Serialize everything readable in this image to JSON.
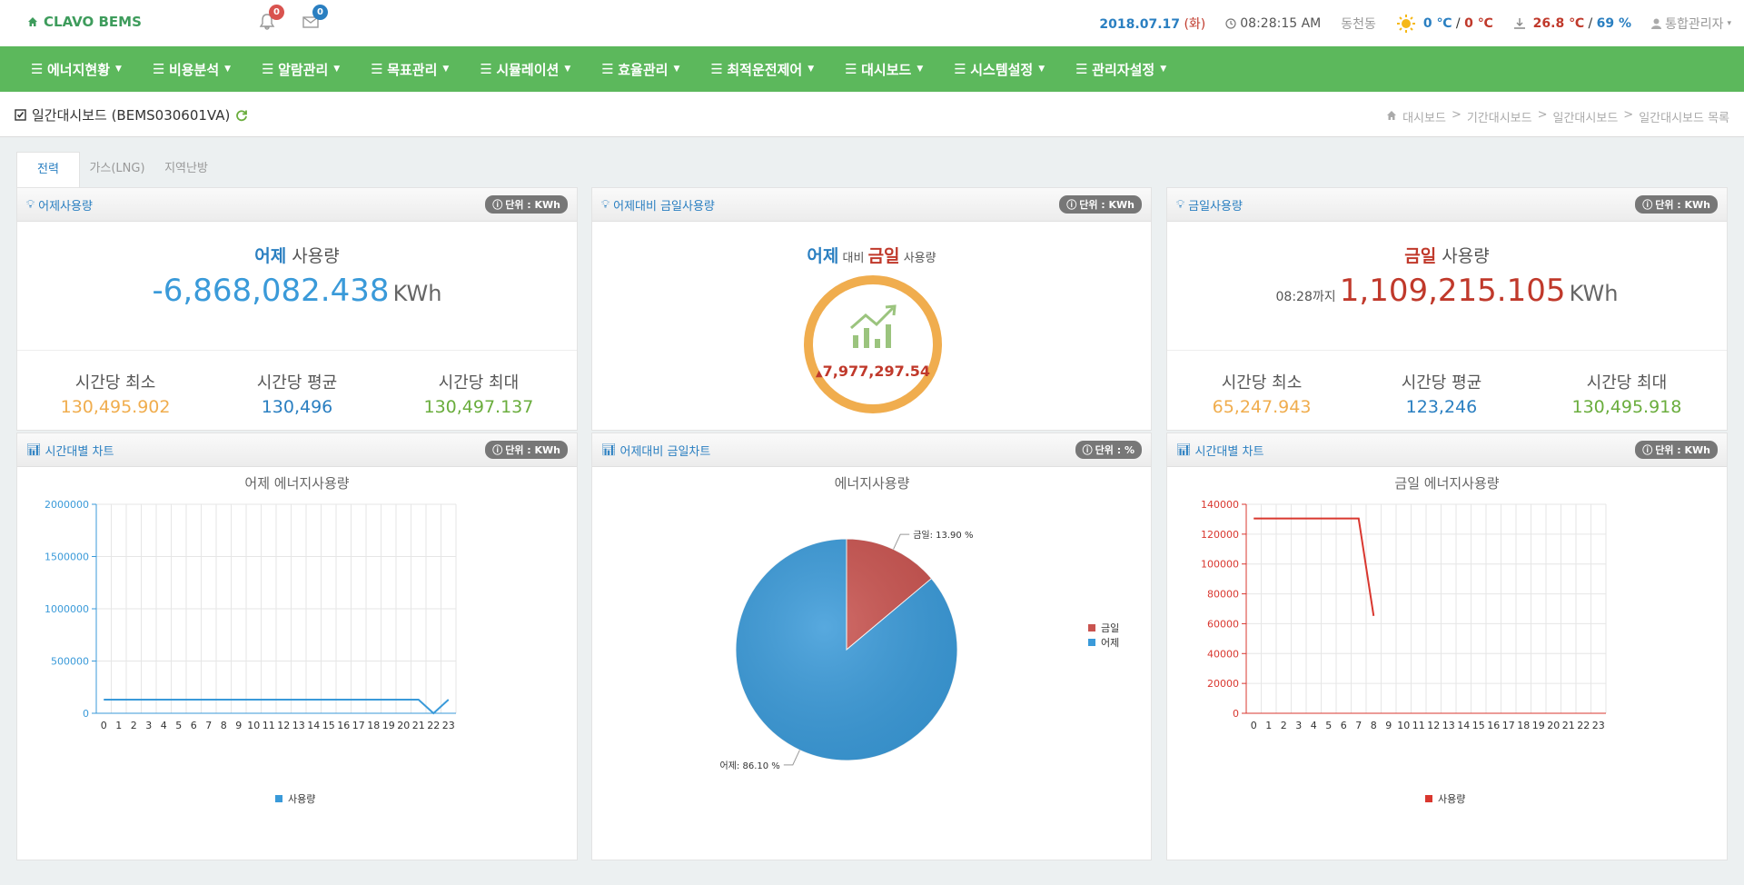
{
  "header": {
    "logo": "CLAVO BEMS",
    "bell_count": "0",
    "mail_count": "0",
    "date": "2018.07.17",
    "day": "(화)",
    "time": "08:28:15 AM",
    "region": "동천동",
    "out_temp1": "0 ℃",
    "out_sep": "/",
    "out_temp2": "0 ℃",
    "in_temp": "26.8 ℃",
    "in_sep": "/",
    "in_humidity": "69 %",
    "user": "통합관리자"
  },
  "nav": [
    "에너지현황",
    "비용분석",
    "알람관리",
    "목표관리",
    "시뮬레이션",
    "효율관리",
    "최적운전제어",
    "대시보드",
    "시스템설정",
    "관리자설정"
  ],
  "page": {
    "title": "일간대시보드 (BEMS030601VA)",
    "breadcrumb": [
      "대시보드",
      ">",
      "기간대시보드",
      ">",
      "일간대시보드",
      ">",
      "일간대시보드 목록"
    ]
  },
  "tabs": [
    "전력",
    "가스(LNG)",
    "지역난방"
  ],
  "panels": {
    "yesterday": {
      "title": "어제사용량",
      "unit": "단위 : KWh",
      "heading_em": "어제",
      "heading_rest": "사용량",
      "value": "-6,868,082.438",
      "value_unit": "KWh",
      "min_label": "시간당 최소",
      "min": "130,495.902",
      "avg_label": "시간당 평균",
      "avg": "130,496",
      "max_label": "시간당 최대",
      "max": "130,497.137"
    },
    "compare": {
      "title": "어제대비 금일사용량",
      "unit": "단위 : KWh",
      "h1": "어제",
      "h2": "대비",
      "h3": "금일",
      "h4": "사용량",
      "diff": "7,977,297.54"
    },
    "today": {
      "title": "금일사용량",
      "unit": "단위 : KWh",
      "heading_em": "금일",
      "heading_rest": "사용량",
      "until": "08:28까지",
      "value": "1,109,215.105",
      "value_unit": "KWh",
      "min_label": "시간당 최소",
      "min": "65,247.943",
      "avg_label": "시간당 평균",
      "avg": "123,246",
      "max_label": "시간당 최대",
      "max": "130,495.918"
    },
    "chart1": {
      "title": "시간대별 차트",
      "unit": "단위 : KWh"
    },
    "chart2": {
      "title": "어제대비 금일차트",
      "unit": "단위 : %"
    },
    "chart3": {
      "title": "시간대별 차트",
      "unit": "단위 : KWh"
    }
  },
  "chart_data": [
    {
      "type": "line",
      "title": "어제 에너지사용량",
      "x": [
        0,
        1,
        2,
        3,
        4,
        5,
        6,
        7,
        8,
        9,
        10,
        11,
        12,
        13,
        14,
        15,
        16,
        17,
        18,
        19,
        20,
        21,
        22,
        23
      ],
      "series": [
        {
          "name": "사용량",
          "color": "#3a9ad9",
          "values": [
            130496,
            130496,
            130496,
            130496,
            130496,
            130496,
            130496,
            130496,
            130496,
            130496,
            130496,
            130496,
            130496,
            130496,
            130496,
            130496,
            130496,
            130496,
            130496,
            130496,
            130496,
            130496,
            0,
            130496
          ]
        }
      ],
      "ylim": [
        0,
        2000000
      ],
      "yticks": [
        0,
        500000,
        1000000,
        1500000,
        2000000
      ],
      "legend": "bottom"
    },
    {
      "type": "pie",
      "title": "에너지사용량",
      "slices": [
        {
          "label": "금일",
          "value": 13.9,
          "text": "금일: 13.90 %",
          "color": "#c9534f"
        },
        {
          "label": "어제",
          "value": 86.1,
          "text": "어제: 86.10 %",
          "color": "#3a9ad9"
        }
      ],
      "legend": "right"
    },
    {
      "type": "line",
      "title": "금일 에너지사용량",
      "x": [
        0,
        1,
        2,
        3,
        4,
        5,
        6,
        7,
        8,
        9,
        10,
        11,
        12,
        13,
        14,
        15,
        16,
        17,
        18,
        19,
        20,
        21,
        22,
        23
      ],
      "series": [
        {
          "name": "사용량",
          "color": "#d9372f",
          "values": [
            130496,
            130496,
            130496,
            130496,
            130496,
            130496,
            130496,
            130496,
            65248
          ]
        }
      ],
      "ylim": [
        0,
        140000
      ],
      "yticks": [
        0,
        20000,
        40000,
        60000,
        80000,
        100000,
        120000,
        140000
      ],
      "legend": "bottom"
    }
  ]
}
